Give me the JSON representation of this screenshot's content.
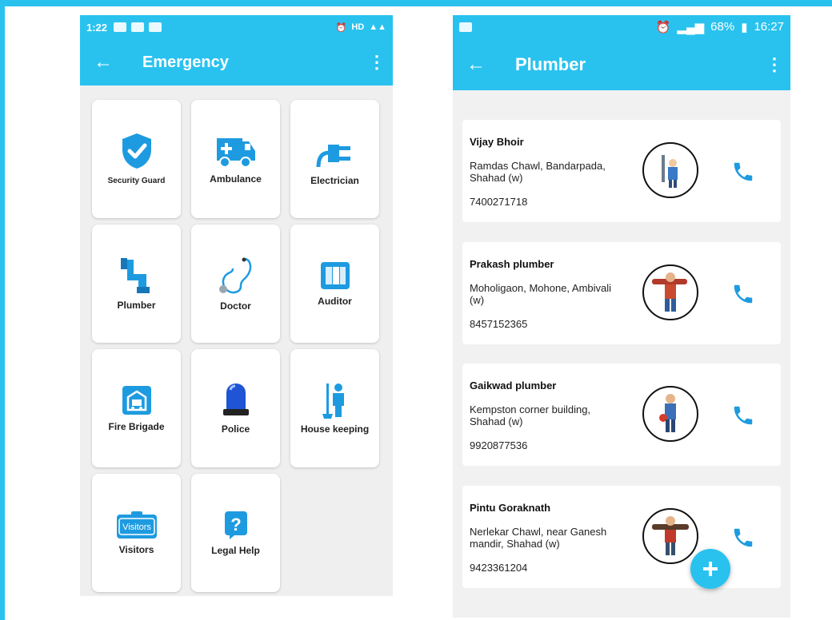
{
  "left_screen": {
    "status": {
      "time": "1:22",
      "right": "HD"
    },
    "title": "Emergency",
    "tiles": [
      {
        "label": "Security Guard",
        "icon": "shield-check-icon"
      },
      {
        "label": "Ambulance",
        "icon": "ambulance-icon"
      },
      {
        "label": "Electrician",
        "icon": "plug-icon"
      },
      {
        "label": "Plumber",
        "icon": "pipe-icon"
      },
      {
        "label": "Doctor",
        "icon": "stethoscope-icon"
      },
      {
        "label": "Auditor",
        "icon": "book-icon"
      },
      {
        "label": "Fire Brigade",
        "icon": "fire-truck-icon"
      },
      {
        "label": "Police",
        "icon": "siren-icon"
      },
      {
        "label": "House keeping",
        "icon": "janitor-icon"
      },
      {
        "label": "Visitors",
        "icon": "visitors-badge-icon",
        "badge_text": "Visitors"
      },
      {
        "label": "Legal Help",
        "icon": "question-icon",
        "icon_text": "?"
      }
    ]
  },
  "right_screen": {
    "status": {
      "time": "16:27",
      "battery": "68%"
    },
    "title": "Plumber",
    "contacts": [
      {
        "name": "Vijay Bhoir",
        "address": "Ramdas Chawl, Bandarpada, Shahad (w)",
        "phone": "7400271718"
      },
      {
        "name": "Prakash plumber",
        "address": "Moholigaon, Mohone, Ambivali (w)",
        "phone": "8457152365"
      },
      {
        "name": "Gaikwad plumber",
        "address": "Kempston corner building, Shahad (w)",
        "phone": "9920877536"
      },
      {
        "name": "Pintu Goraknath",
        "address": "Nerlekar Chawl, near Ganesh mandir, Shahad (w)",
        "phone": "9423361204"
      }
    ]
  },
  "colors": {
    "accent": "#29c2ef",
    "icon_blue": "#1e9be0"
  }
}
